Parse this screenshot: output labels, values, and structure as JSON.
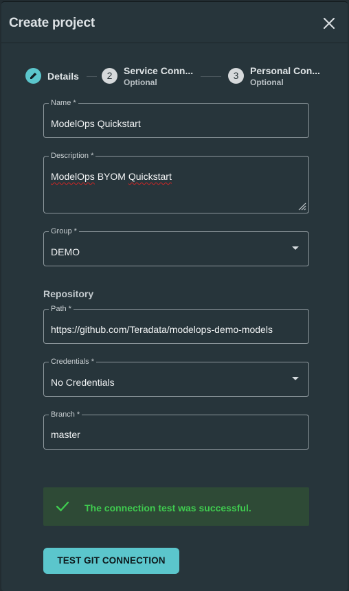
{
  "dialog": {
    "title": "Create project"
  },
  "stepper": {
    "steps": [
      {
        "number": "",
        "label": "Details",
        "sublabel": ""
      },
      {
        "number": "2",
        "label": "Service Conn...",
        "sublabel": "Optional"
      },
      {
        "number": "3",
        "label": "Personal Con...",
        "sublabel": "Optional"
      }
    ]
  },
  "form": {
    "name": {
      "label": "Name *",
      "value": "ModelOps Quickstart"
    },
    "description": {
      "label": "Description *",
      "value_part1": "ModelOps",
      "value_part2": " BYOM ",
      "value_part3": "Quickstart"
    },
    "group": {
      "label": "Group *",
      "value": "DEMO"
    },
    "repository_heading": "Repository",
    "path": {
      "label": "Path *",
      "value": "https://github.com/Teradata/modelops-demo-models"
    },
    "credentials": {
      "label": "Credentials *",
      "value": "No Credentials"
    },
    "branch": {
      "label": "Branch *",
      "value": "master"
    }
  },
  "alert": {
    "message": "The connection test was successful.",
    "color": "#3fcb4f"
  },
  "actions": {
    "test_label": "TEST GIT CONNECTION"
  },
  "colors": {
    "accent": "#5bc6cc",
    "background": "#27353b",
    "success_bg": "#2e4a36"
  }
}
